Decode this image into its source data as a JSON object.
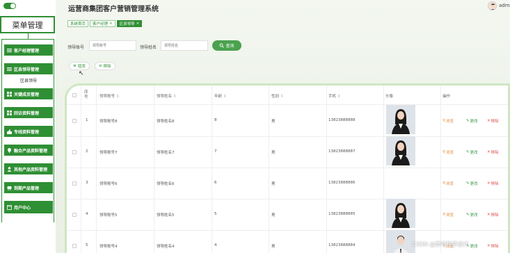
{
  "header": {
    "title": "运营商集团客户营销管理系统",
    "user": "adm"
  },
  "sidebar": {
    "title": "菜单管理",
    "items": [
      {
        "label": "客户经理管理",
        "icon": "list-icon"
      },
      {
        "label": "区县领导管理",
        "icon": "list-icon"
      },
      {
        "label": "关键成员管理",
        "icon": "grid-icon"
      },
      {
        "label": "回访资料管理",
        "icon": "grid-icon"
      },
      {
        "label": "专线资料管理",
        "icon": "thumb-icon"
      },
      {
        "label": "融合产品资料管理",
        "icon": "location-icon"
      },
      {
        "label": "其他产品资料管理",
        "icon": "person-icon"
      },
      {
        "label": "到期产品管理",
        "icon": "car-icon"
      },
      {
        "label": "用户中心",
        "icon": "window-icon"
      }
    ],
    "sub_item": "区县领导"
  },
  "tabs": [
    {
      "label": "系统首页"
    },
    {
      "label": "客户经理"
    },
    {
      "label": "区县领导"
    }
  ],
  "search": {
    "field1_label": "领导账号",
    "field1_placeholder": "领导账号",
    "field2_label": "领导姓名",
    "field2_placeholder": "领导姓名",
    "button": "查询"
  },
  "actions": {
    "add": "增添",
    "remove": "移除"
  },
  "table": {
    "columns": [
      "序号",
      "领导账号",
      "领导姓名",
      "年龄",
      "性别",
      "手机",
      "头像",
      "操作"
    ],
    "rows": [
      {
        "index": "1",
        "account": "领导账号8",
        "name": "领导姓名8",
        "age": "8",
        "gender": "男",
        "phone": "13823888888",
        "photo": "female"
      },
      {
        "index": "2",
        "account": "领导账号7",
        "name": "领导姓名7",
        "age": "7",
        "gender": "男",
        "phone": "13823888887",
        "photo": "female"
      },
      {
        "index": "3",
        "account": "领导账号6",
        "name": "领导姓名6",
        "age": "6",
        "gender": "男",
        "phone": "13823888886",
        "photo": ""
      },
      {
        "index": "4",
        "account": "领导账号5",
        "name": "领导姓名5",
        "age": "5",
        "gender": "男",
        "phone": "13823888885",
        "photo": "female"
      },
      {
        "index": "5",
        "account": "领导账号4",
        "name": "领导姓名4",
        "age": "4",
        "gender": "男",
        "phone": "13823888884",
        "photo": "male"
      }
    ],
    "ops": {
      "view": "浏览",
      "edit": "更改",
      "delete": "移除"
    }
  },
  "watermark": "CSDN @黄可程序设计",
  "colors": {
    "primary": "#2f8f34",
    "view": "#e08a3a",
    "edit": "#3a9a4a",
    "delete": "#d9534f"
  }
}
